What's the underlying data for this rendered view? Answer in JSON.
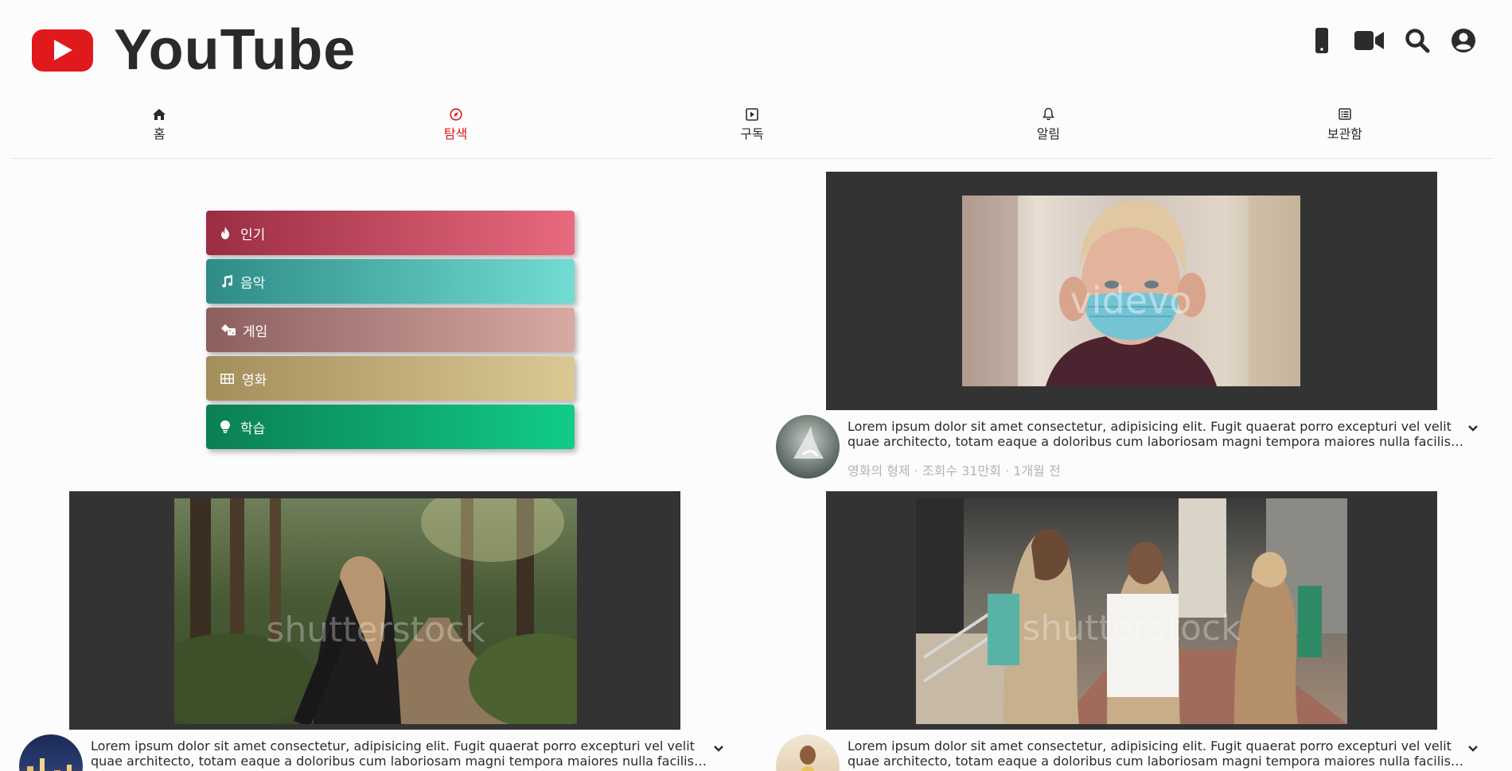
{
  "header": {
    "logo_text": "YouTube",
    "icons": [
      "mobile-icon",
      "video-camera-icon",
      "search-icon",
      "account-icon"
    ]
  },
  "nav": {
    "items": [
      {
        "label": "홈",
        "icon": "home-icon"
      },
      {
        "label": "탐색",
        "icon": "compass-icon",
        "active": true
      },
      {
        "label": "구독",
        "icon": "play-square-icon"
      },
      {
        "label": "알림",
        "icon": "bell-icon"
      },
      {
        "label": "보관함",
        "icon": "list-icon"
      }
    ],
    "active_color": "#d8191d"
  },
  "categories": [
    {
      "label": "인기",
      "icon": "fire-icon",
      "gradient": [
        "#9b2d42",
        "#e86a7f"
      ]
    },
    {
      "label": "음악",
      "icon": "music-icon",
      "gradient": [
        "#2e8b86",
        "#72dcd3"
      ]
    },
    {
      "label": "게임",
      "icon": "dice-icon",
      "gradient": [
        "#8c5f5f",
        "#d9aaa3"
      ]
    },
    {
      "label": "영화",
      "icon": "film-icon",
      "gradient": [
        "#a38e5c",
        "#dbc994"
      ]
    },
    {
      "label": "학습",
      "icon": "lightbulb-icon",
      "gradient": [
        "#0b7f52",
        "#11cc88"
      ]
    }
  ],
  "videos": [
    {
      "title": "Lorem ipsum dolor sit amet consectetur, adipisicing elit. Fugit quaerat porro excepturi vel velit quae architecto, totam eaque a doloribus cum laboriosam magni tempora maiores nulla facilis saepe cupiditate.",
      "channel": "영화의 형제",
      "views": "조회수 31만회",
      "age": "1개월 전",
      "watermark": "videvo"
    },
    {
      "title": "Lorem ipsum dolor sit amet consectetur, adipisicing elit. Fugit quaerat porro excepturi vel velit quae architecto, totam eaque a doloribus cum laboriosam magni tempora maiores nulla facilis saepe cupiditate.",
      "watermark": "shutterstock"
    },
    {
      "title": "Lorem ipsum dolor sit amet consectetur, adipisicing elit. Fugit quaerat porro excepturi vel velit quae architecto, totam eaque a doloribus cum laboriosam magni tempora maiores nulla facilis saepe cupiditate.",
      "watermark": "shutterstock"
    }
  ],
  "colors": {
    "frame": "#333333",
    "brand_red": "#e0191d",
    "meta_gray": "#b4b4b4"
  }
}
